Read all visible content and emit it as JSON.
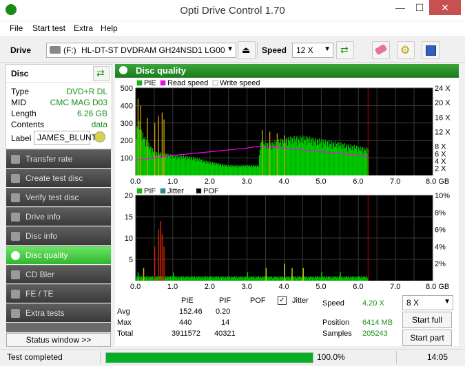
{
  "window": {
    "title": "Opti Drive Control 1.70",
    "minimize": "—",
    "maximize": "☐",
    "close": "✕"
  },
  "menu": [
    "File",
    "Start test",
    "Extra",
    "Help"
  ],
  "toolbar": {
    "drive_label": "Drive",
    "drive_letter": "(F:)",
    "drive_name": "HL-DT-ST DVDRAM GH24NSD1 LG00",
    "speed_label": "Speed",
    "speed_value": "12 X"
  },
  "disc": {
    "header": "Disc",
    "rows": [
      {
        "key": "Type",
        "value": "DVD+R DL"
      },
      {
        "key": "MID",
        "value": "CMC MAG D03"
      },
      {
        "key": "Length",
        "value": "6.26 GB"
      },
      {
        "key": "Contents",
        "value": "data"
      }
    ],
    "label_key": "Label",
    "label_value": "JAMES_BLUNT"
  },
  "nav": [
    {
      "label": "Transfer rate",
      "active": false
    },
    {
      "label": "Create test disc",
      "active": false
    },
    {
      "label": "Verify test disc",
      "active": false
    },
    {
      "label": "Drive info",
      "active": false
    },
    {
      "label": "Disc info",
      "active": false
    },
    {
      "label": "Disc quality",
      "active": true
    },
    {
      "label": "CD Bler",
      "active": false
    },
    {
      "label": "FE / TE",
      "active": false
    },
    {
      "label": "Extra tests",
      "active": false
    }
  ],
  "status_window_button": "Status window >>",
  "panel_title": "Disc quality",
  "chart_data": [
    {
      "type": "area",
      "legend": [
        "PIE",
        "Read speed",
        "Write speed"
      ],
      "colors": {
        "PIE": "#00c800",
        "PIE_peak": "#c8a000",
        "Read speed": "#ff00ff",
        "Write speed": "#ffffff"
      },
      "x_ticks": [
        "0.0",
        "1.0",
        "2.0",
        "3.0",
        "4.0",
        "5.0",
        "6.0",
        "7.0",
        "8.0 GB"
      ],
      "y_left_ticks": [
        "100",
        "200",
        "300",
        "400",
        "500"
      ],
      "y_right_ticks": [
        "2 X",
        "4 X",
        "6 X",
        "8 X",
        "12 X",
        "16 X",
        "20 X",
        "24 X"
      ],
      "xlim": [
        0,
        8
      ],
      "ylim": [
        0,
        500
      ],
      "end_marker_gb": 6.26,
      "pie_profile": [
        [
          0.0,
          280
        ],
        [
          0.1,
          320
        ],
        [
          0.15,
          260
        ],
        [
          0.3,
          200
        ],
        [
          0.5,
          140
        ],
        [
          0.8,
          130
        ],
        [
          1.0,
          120
        ],
        [
          1.5,
          110
        ],
        [
          2.0,
          80
        ],
        [
          2.5,
          60
        ],
        [
          3.0,
          60
        ],
        [
          3.3,
          60
        ],
        [
          3.35,
          200
        ],
        [
          3.6,
          190
        ],
        [
          4.0,
          220
        ],
        [
          4.5,
          230
        ],
        [
          5.0,
          210
        ],
        [
          5.5,
          190
        ],
        [
          6.0,
          170
        ],
        [
          6.26,
          160
        ]
      ],
      "pie_peaks": [
        [
          0.05,
          440
        ],
        [
          0.12,
          400
        ],
        [
          0.3,
          330
        ],
        [
          0.5,
          300
        ],
        [
          0.6,
          340
        ],
        [
          0.7,
          360
        ],
        [
          0.75,
          320
        ],
        [
          3.4,
          260
        ],
        [
          3.6,
          250
        ],
        [
          3.8,
          240
        ],
        [
          4.0,
          230
        ]
      ],
      "read_speed": [
        [
          0.0,
          4.2
        ],
        [
          0.5,
          4.8
        ],
        [
          1.0,
          5.5
        ],
        [
          1.5,
          6.0
        ],
        [
          2.0,
          6.5
        ],
        [
          2.5,
          7.0
        ],
        [
          3.0,
          7.5
        ],
        [
          3.3,
          8.0
        ],
        [
          3.6,
          7.8
        ],
        [
          4.0,
          7.5
        ],
        [
          4.5,
          7.0
        ],
        [
          5.0,
          6.5
        ],
        [
          5.5,
          6.0
        ],
        [
          6.0,
          5.5
        ],
        [
          6.26,
          5.2
        ]
      ]
    },
    {
      "type": "bar",
      "legend": [
        "PIF",
        "Jitter",
        "POF"
      ],
      "colors": {
        "PIF": "#00c800",
        "Jitter": "#2e8b8b",
        "POF": "#000000"
      },
      "x_ticks": [
        "0.0",
        "1.0",
        "2.0",
        "3.0",
        "4.0",
        "5.0",
        "6.0",
        "7.0",
        "8.0 GB"
      ],
      "y_left_ticks": [
        "5",
        "10",
        "15",
        "20"
      ],
      "y_right_ticks": [
        "2%",
        "4%",
        "6%",
        "8%",
        "10%"
      ],
      "xlim": [
        0,
        8
      ],
      "ylim": [
        0,
        20
      ],
      "end_marker_gb": 6.26,
      "pif_peaks": [
        [
          0.05,
          2
        ],
        [
          0.2,
          3
        ],
        [
          0.5,
          8
        ],
        [
          0.6,
          12
        ],
        [
          0.65,
          14
        ],
        [
          0.7,
          11
        ],
        [
          0.75,
          8
        ],
        [
          1.0,
          2
        ],
        [
          2.0,
          1
        ],
        [
          3.0,
          2
        ],
        [
          3.5,
          3
        ],
        [
          4.0,
          4
        ],
        [
          4.2,
          3
        ],
        [
          4.5,
          3
        ],
        [
          5.0,
          2
        ],
        [
          5.5,
          2
        ],
        [
          6.0,
          1
        ]
      ]
    }
  ],
  "stats": {
    "headers": [
      "PIE",
      "PIF",
      "POF",
      "Jitter"
    ],
    "rows": [
      {
        "label": "Avg",
        "pie": "152.46",
        "pif": "0.20",
        "pof": ""
      },
      {
        "label": "Max",
        "pie": "440",
        "pif": "14",
        "pof": ""
      },
      {
        "label": "Total",
        "pie": "3911572",
        "pif": "40321",
        "pof": ""
      }
    ],
    "speed_label": "Speed",
    "speed_value": "4.20 X",
    "position_label": "Position",
    "position_value": "6414 MB",
    "samples_label": "Samples",
    "samples_value": "205243",
    "speed_select": "8 X",
    "start_full": "Start full",
    "start_part": "Start part"
  },
  "status": {
    "text": "Test completed",
    "progress": 1.0,
    "progress_text": "100.0%",
    "time": "14:05"
  }
}
